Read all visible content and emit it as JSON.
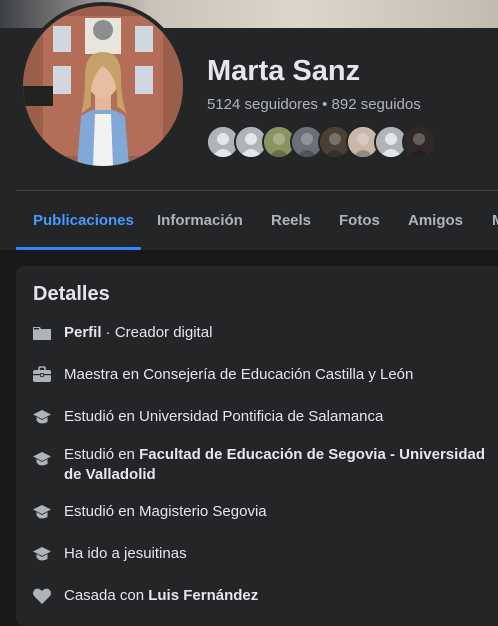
{
  "profile": {
    "name": "Marta Sanz",
    "stats": "5124 seguidores • 892 seguidos"
  },
  "friends": [
    {
      "icon": "default-avatar-icon",
      "color": "#b0b3b8"
    },
    {
      "icon": "default-avatar-icon",
      "color": "#b0b3b8"
    },
    {
      "icon": "friend-photo",
      "color": "#8a9460"
    },
    {
      "icon": "friend-photo",
      "color": "#6a6f7a"
    },
    {
      "icon": "friend-photo",
      "color": "#4a4036"
    },
    {
      "icon": "friend-photo",
      "color": "#c9b8a8"
    },
    {
      "icon": "default-avatar-icon",
      "color": "#b0b3b8"
    },
    {
      "icon": "friend-photo",
      "color": "#2f2a28"
    }
  ],
  "tabs": [
    {
      "label": "Publicaciones",
      "active": true
    },
    {
      "label": "Información"
    },
    {
      "label": "Reels"
    },
    {
      "label": "Fotos"
    },
    {
      "label": "Amigos"
    },
    {
      "label": "M"
    }
  ],
  "details": {
    "title": "Detalles",
    "perfil_strong": "Perfil",
    "perfil_rest": " · Creador digital",
    "work": "Maestra en Consejería de Educación Castilla y León",
    "edu1": "Estudió en Universidad Pontificia de Salamanca",
    "edu2_prefix": "Estudió en ",
    "edu2_strong": "Facultad de Educación de Segovia - Universidad de Valladolid",
    "edu3": "Estudió en Magisterio Segovia",
    "edu4": "Ha ido a jesuitinas",
    "rel_prefix": "Casada con ",
    "rel_strong": "Luis Fernández"
  },
  "colors": {
    "accent": "#2d88ff",
    "background": "#18191a",
    "card": "#242526",
    "text_primary": "#e4e6eb",
    "text_secondary": "#b0b3b8"
  }
}
